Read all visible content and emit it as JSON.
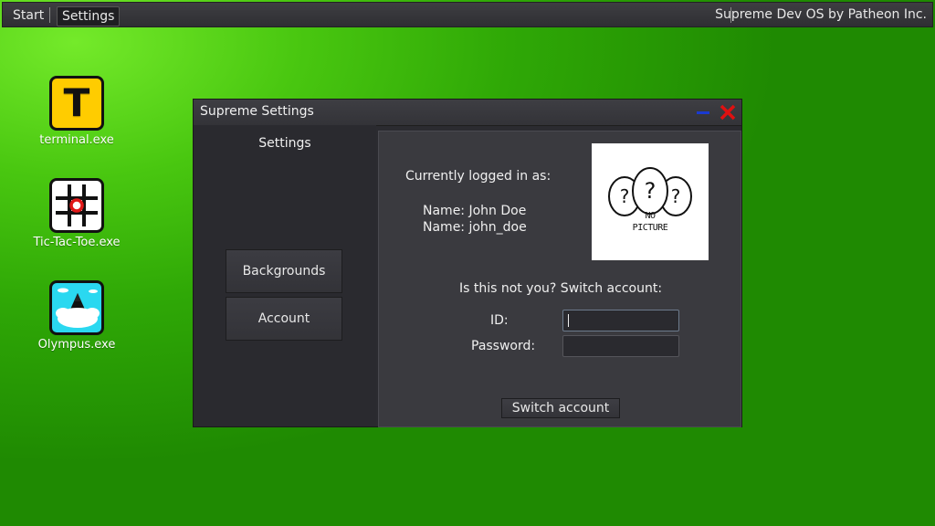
{
  "taskbar": {
    "start_label": "Start",
    "settings_label": "Settings",
    "os_title": "Supreme Dev OS by Patheon Inc."
  },
  "desktop": {
    "icons": [
      {
        "label": "terminal.exe",
        "icon": "terminal-icon",
        "glyph": "T",
        "color": "#ffcc00"
      },
      {
        "label": "Tic-Tac-Toe.exe",
        "icon": "tic-tac-toe-icon",
        "color": "#ffffff"
      },
      {
        "label": "Olympus.exe",
        "icon": "olympus-icon",
        "color": "#2ad8f0"
      }
    ]
  },
  "window": {
    "title": "Supreme Settings",
    "sidebar": {
      "title": "Settings",
      "buttons": [
        "Backgrounds",
        "Account"
      ]
    },
    "account": {
      "logged_in_heading": "Currently logged in as:",
      "name_line": "Name: John Doe",
      "username_line": "Name: john_doe",
      "picture_text_1": "NO",
      "picture_text_2": "PICTURE",
      "switch_prompt": "Is this not you? Switch account:",
      "id_label": "ID:",
      "id_value": "",
      "password_label": "Password:",
      "password_value": "",
      "switch_button": "Switch account"
    }
  },
  "colors": {
    "close_icon": "#e01010",
    "minimize_icon": "#1a3ad0",
    "desktop_green": "#49c710"
  }
}
